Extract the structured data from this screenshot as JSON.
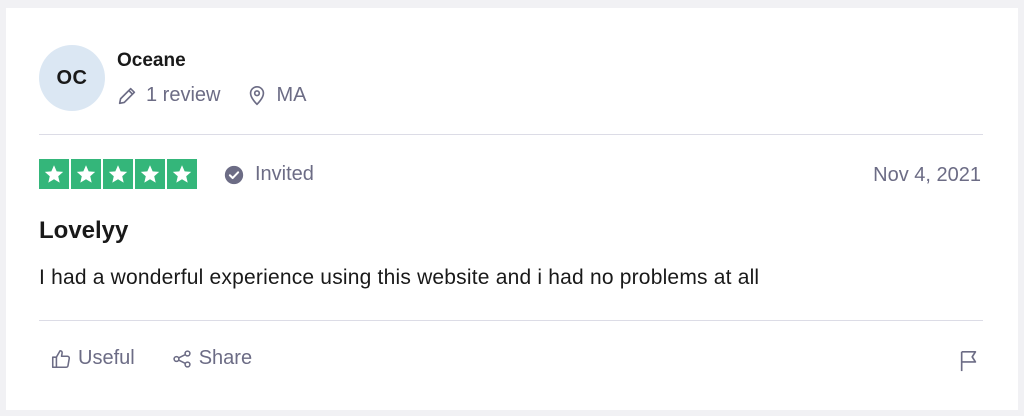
{
  "reviewer": {
    "initials": "OC",
    "name": "Oceane",
    "review_count": "1 review",
    "location": "MA"
  },
  "rating": {
    "stars": 5,
    "max_stars": 5,
    "star_color": "#34b67a"
  },
  "verification": {
    "label": "Invited",
    "icon": "check-circle-icon"
  },
  "date": "Nov 4, 2021",
  "review": {
    "title": "Lovelyy",
    "body": "I had a wonderful experience using this website and i had no problems at all"
  },
  "actions": {
    "useful_label": "Useful",
    "share_label": "Share",
    "report_icon": "flag-icon"
  },
  "colors": {
    "avatar_bg": "#dbe7f3",
    "muted_text": "#6c6c85",
    "divider": "#dcdce6"
  }
}
